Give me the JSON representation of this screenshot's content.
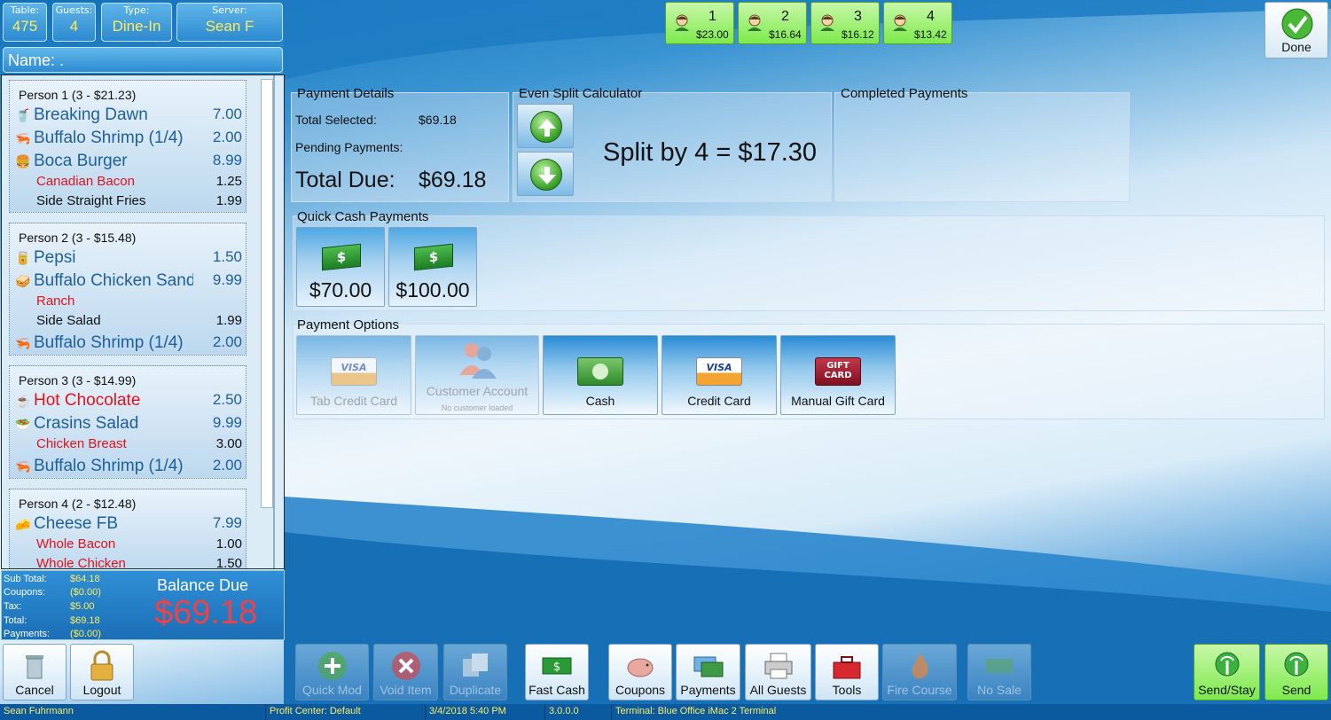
{
  "header": {
    "table": {
      "label": "Table:",
      "value": "475"
    },
    "guests": {
      "label": "Guests:",
      "value": "4"
    },
    "type": {
      "label": "Type:",
      "value": "Dine-In"
    },
    "server": {
      "label": "Server:",
      "value": "Sean F"
    },
    "name": "Name: ."
  },
  "guests": [
    {
      "num": "1",
      "amount": "$23.00"
    },
    {
      "num": "2",
      "amount": "$16.64"
    },
    {
      "num": "3",
      "amount": "$16.12"
    },
    {
      "num": "4",
      "amount": "$13.42"
    }
  ],
  "done_label": "Done",
  "order": {
    "persons": [
      {
        "header": "Person 1 (3 - $21.23)",
        "lines": [
          {
            "kind": "item",
            "icon": "drink-icon",
            "glyph": "🥤",
            "name": "Breaking Dawn",
            "price": "7.00"
          },
          {
            "kind": "item",
            "icon": "shrimp-icon",
            "glyph": "🦐",
            "name": "Buffalo Shrimp (1/4)",
            "price": "2.00"
          },
          {
            "kind": "item",
            "icon": "burger-icon",
            "glyph": "🍔",
            "name": "Boca Burger",
            "price": "8.99"
          },
          {
            "kind": "mod",
            "red": true,
            "name": "Canadian Bacon",
            "price": "1.25"
          },
          {
            "kind": "mod",
            "red": false,
            "name": "Side Straight Fries",
            "price": "1.99"
          }
        ]
      },
      {
        "header": "Person 2 (3 - $15.48)",
        "lines": [
          {
            "kind": "item",
            "icon": "pepsi-icon",
            "glyph": "🥫",
            "name": "Pepsi",
            "price": "1.50"
          },
          {
            "kind": "item",
            "icon": "sandwich-icon",
            "glyph": "🥪",
            "name": "Buffalo Chicken Sandwich",
            "price": "9.99"
          },
          {
            "kind": "mod",
            "red": true,
            "name": "Ranch",
            "price": ""
          },
          {
            "kind": "mod",
            "red": false,
            "name": "Side Salad",
            "price": "1.99"
          },
          {
            "kind": "item",
            "icon": "shrimp-icon",
            "glyph": "🦐",
            "name": "Buffalo Shrimp (1/4)",
            "price": "2.00"
          }
        ]
      },
      {
        "header": "Person 3 (3 - $14.99)",
        "lines": [
          {
            "kind": "item",
            "red": true,
            "icon": "hot-chocolate-icon",
            "glyph": "☕",
            "name": "Hot Chocolate",
            "price": "2.50"
          },
          {
            "kind": "item",
            "icon": "salad-icon",
            "glyph": "🥗",
            "name": "Crasins Salad",
            "price": "9.99"
          },
          {
            "kind": "mod",
            "red": true,
            "name": "Chicken Breast",
            "price": "3.00"
          },
          {
            "kind": "item",
            "icon": "shrimp-icon",
            "glyph": "🦐",
            "name": "Buffalo Shrimp (1/4)",
            "price": "2.00"
          }
        ]
      },
      {
        "header": "Person 4 (2 - $12.48)",
        "lines": [
          {
            "kind": "item",
            "icon": "cheese-fries-icon",
            "glyph": "🧀",
            "name": "Cheese FB",
            "price": "7.99"
          },
          {
            "kind": "mod",
            "red": true,
            "name": "Whole Bacon",
            "price": "1.00"
          },
          {
            "kind": "mod",
            "red": true,
            "name": "Whole Chicken",
            "price": "1.50"
          }
        ]
      }
    ]
  },
  "totals": {
    "subtotal": {
      "label": "Sub Total:",
      "value": "$64.18"
    },
    "coupons": {
      "label": "Coupons:",
      "value": "($0.00)"
    },
    "tax": {
      "label": "Tax:",
      "value": "$5.00"
    },
    "total": {
      "label": "Total:",
      "value": "$69.18"
    },
    "payments": {
      "label": "Payments:",
      "value": "($0.00)"
    },
    "balance_label": "Balance Due",
    "balance_value": "$69.18"
  },
  "payment_details": {
    "title": "Payment Details",
    "total_selected_label": "Total Selected:",
    "total_selected_value": "$69.18",
    "pending_label": "Pending Payments:",
    "total_due_label": "Total Due:",
    "total_due_value": "$69.18"
  },
  "even_split": {
    "title": "Even Split Calculator",
    "text": "Split by 4  =  $17.30"
  },
  "completed_payments": {
    "title": "Completed Payments"
  },
  "quick_cash": {
    "title": "Quick Cash Payments",
    "buttons": [
      "$70.00",
      "$100.00"
    ]
  },
  "payment_options": {
    "title": "Payment Options",
    "tab_credit_card": "Tab Credit Card",
    "customer_account": "Customer Account",
    "customer_account_sub": "No customer loaded",
    "cash": "Cash",
    "credit_card": "Credit Card",
    "manual_gift_card": "Manual Gift Card"
  },
  "toolbar": {
    "cancel": "Cancel",
    "logout": "Logout",
    "quick_mod": "Quick Mod",
    "void_item": "Void Item",
    "duplicate": "Duplicate",
    "fast_cash": "Fast Cash",
    "coupons": "Coupons",
    "payments": "Payments",
    "all_guests": "All Guests",
    "tools": "Tools",
    "fire_course": "Fire Course",
    "no_sale": "No Sale",
    "send_stay": "Send/Stay",
    "send": "Send"
  },
  "status": {
    "user": "Sean Fuhrmann",
    "profit_center": "Profit Center: Default",
    "datetime": "3/4/2018 5:40 PM",
    "version": "3.0.0.0",
    "terminal": "Terminal: Blue Office iMac 2 Terminal"
  },
  "colors": {
    "accent_blue": "#2d8ad0",
    "guest_green": "#7dea4c",
    "balance_red": "#ef4146",
    "value_yellow": "#ffec5a"
  }
}
